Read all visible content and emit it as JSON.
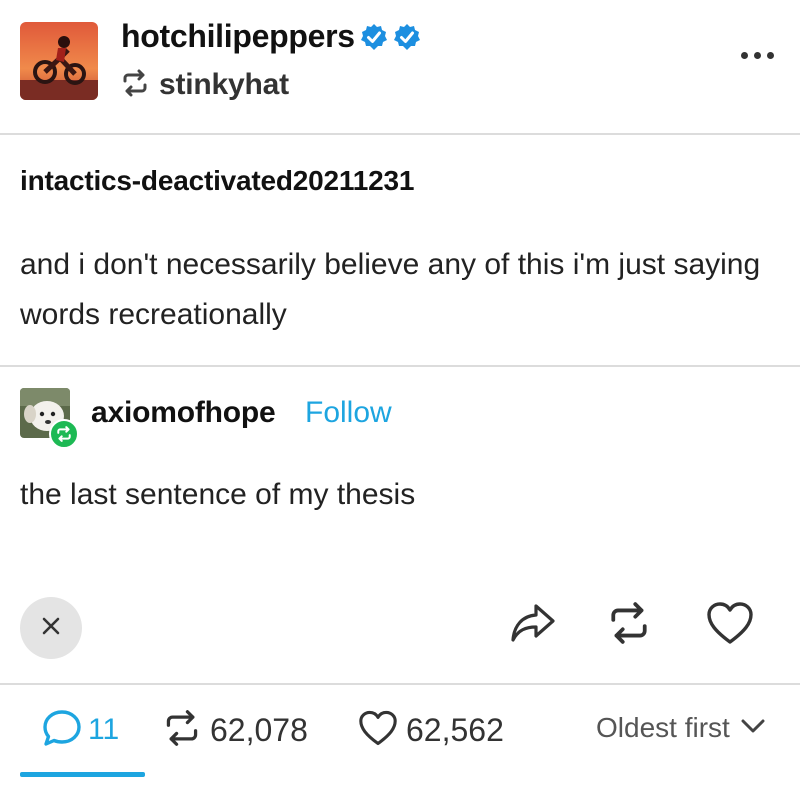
{
  "header": {
    "username": "hotchilipeppers",
    "reblogged_from": "stinkyhat",
    "more_label": "More options"
  },
  "trail": {
    "username": "intactics-deactivated20211231",
    "text": "and i don't necessarily believe any of this i'm just saying words recreationally"
  },
  "reblog": {
    "username": "axiomofhope",
    "follow_label": "Follow",
    "text": "the last sentence of my thesis"
  },
  "actions": {
    "close_icon": "close-icon",
    "share_icon": "share-icon",
    "reblog_icon": "reblog-icon",
    "like_icon": "heart-icon"
  },
  "stats": {
    "replies": "11",
    "reblogs": "62,078",
    "likes": "62,562",
    "sort_label": "Oldest first"
  },
  "colors": {
    "accent": "#1da5e0",
    "verified": "#1d8fe0",
    "reblog_badge": "#1db954"
  }
}
